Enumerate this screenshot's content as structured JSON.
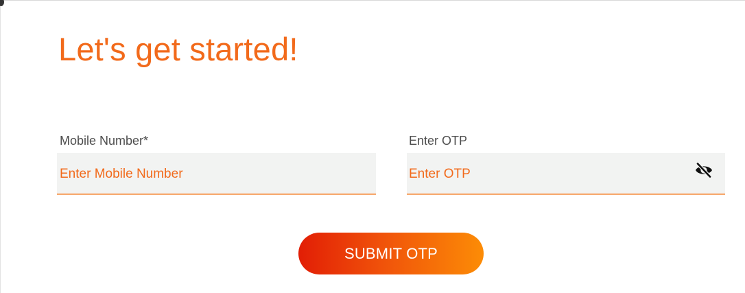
{
  "page": {
    "title": "Let's get started!",
    "accent_color": "#f26a1b"
  },
  "form": {
    "mobile": {
      "label": "Mobile Number*",
      "placeholder": "Enter Mobile Number",
      "value": ""
    },
    "otp": {
      "label": "Enter OTP",
      "placeholder": "Enter OTP",
      "value": "",
      "visibility_icon": "eye-slash-icon"
    },
    "submit_label": "SUBMIT OTP"
  }
}
